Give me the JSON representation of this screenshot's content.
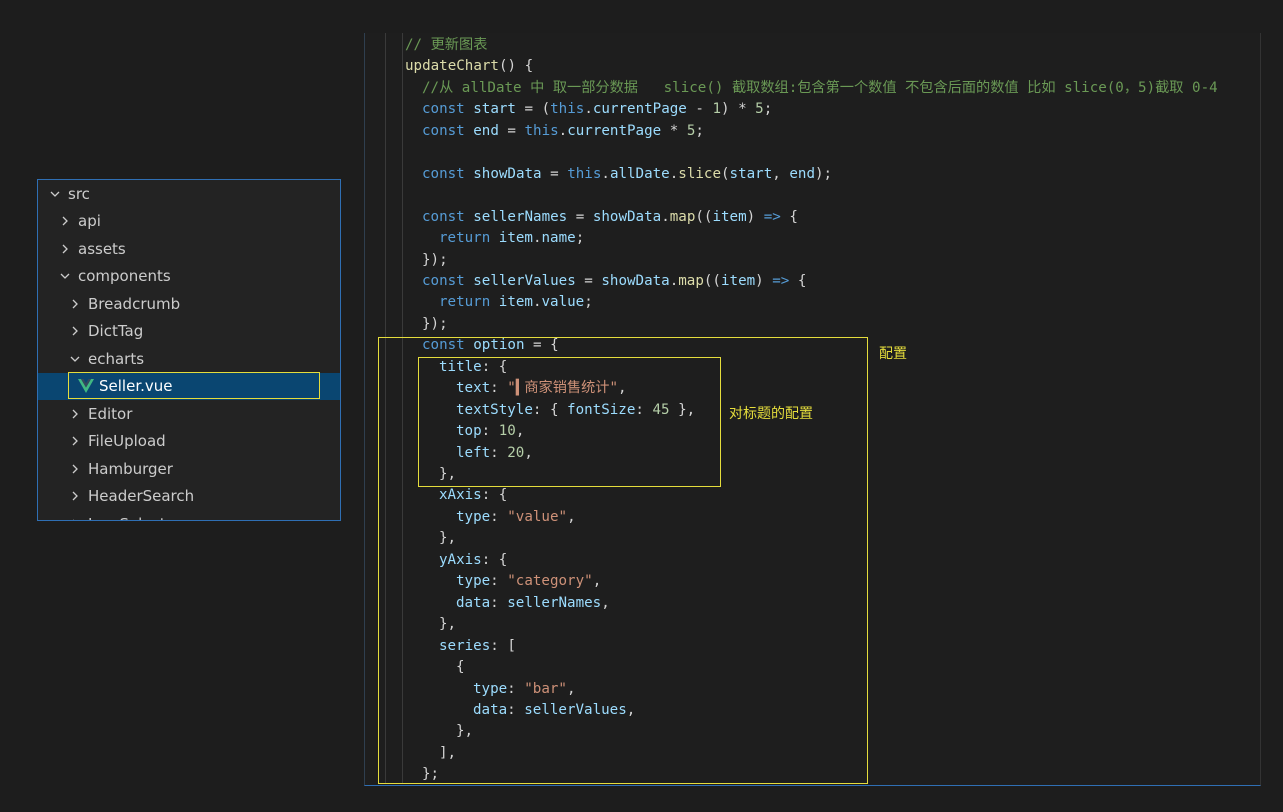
{
  "explorer": {
    "items": [
      {
        "label": "src",
        "state": "open",
        "indent": 0
      },
      {
        "label": "api",
        "state": "closed",
        "indent": 1
      },
      {
        "label": "assets",
        "state": "closed",
        "indent": 1
      },
      {
        "label": "components",
        "state": "open",
        "indent": 1
      },
      {
        "label": "Breadcrumb",
        "state": "closed",
        "indent": 2
      },
      {
        "label": "DictTag",
        "state": "closed",
        "indent": 2
      },
      {
        "label": "echarts",
        "state": "open",
        "indent": 2
      },
      {
        "label": "Seller.vue",
        "state": "file",
        "indent": 3,
        "selected": true
      },
      {
        "label": "Editor",
        "state": "closed",
        "indent": 2
      },
      {
        "label": "FileUpload",
        "state": "closed",
        "indent": 2
      },
      {
        "label": "Hamburger",
        "state": "closed",
        "indent": 2
      },
      {
        "label": "HeaderSearch",
        "state": "closed",
        "indent": 2
      },
      {
        "label": "IconSelect",
        "state": "closed",
        "indent": 2
      }
    ],
    "accent_color": "#2f6fb4",
    "vue_icon_color": "#41b883"
  },
  "code": {
    "lines": [
      {
        "indent": 2,
        "tokens": [
          [
            "cmt",
            "// 更新图表"
          ]
        ]
      },
      {
        "indent": 2,
        "tokens": [
          [
            "fn",
            "updateChart"
          ],
          [
            "txt",
            "() {"
          ]
        ]
      },
      {
        "indent": 3,
        "tokens": [
          [
            "cmt",
            "//从 allDate 中 取一部分数据   slice() 截取数组:包含第一个数值 不包含后面的数值 比如 slice(0，5)截取 0-4"
          ]
        ]
      },
      {
        "indent": 3,
        "tokens": [
          [
            "kw",
            "const "
          ],
          [
            "var",
            "start"
          ],
          [
            "txt",
            " = ("
          ],
          [
            "kw",
            "this"
          ],
          [
            "txt",
            "."
          ],
          [
            "var",
            "currentPage"
          ],
          [
            "txt",
            " - "
          ],
          [
            "num",
            "1"
          ],
          [
            "txt",
            ") * "
          ],
          [
            "num",
            "5"
          ],
          [
            "txt",
            ";"
          ]
        ]
      },
      {
        "indent": 3,
        "tokens": [
          [
            "kw",
            "const "
          ],
          [
            "var",
            "end"
          ],
          [
            "txt",
            " = "
          ],
          [
            "kw",
            "this"
          ],
          [
            "txt",
            "."
          ],
          [
            "var",
            "currentPage"
          ],
          [
            "txt",
            " * "
          ],
          [
            "num",
            "5"
          ],
          [
            "txt",
            ";"
          ]
        ]
      },
      {
        "indent": 3,
        "tokens": []
      },
      {
        "indent": 3,
        "tokens": [
          [
            "kw",
            "const "
          ],
          [
            "var",
            "showData"
          ],
          [
            "txt",
            " = "
          ],
          [
            "kw",
            "this"
          ],
          [
            "txt",
            "."
          ],
          [
            "var",
            "allDate"
          ],
          [
            "txt",
            "."
          ],
          [
            "fn",
            "slice"
          ],
          [
            "txt",
            "("
          ],
          [
            "var",
            "start"
          ],
          [
            "txt",
            ", "
          ],
          [
            "var",
            "end"
          ],
          [
            "txt",
            ");"
          ]
        ]
      },
      {
        "indent": 3,
        "tokens": []
      },
      {
        "indent": 3,
        "tokens": [
          [
            "kw",
            "const "
          ],
          [
            "var",
            "sellerNames"
          ],
          [
            "txt",
            " = "
          ],
          [
            "var",
            "showData"
          ],
          [
            "txt",
            "."
          ],
          [
            "fn",
            "map"
          ],
          [
            "txt",
            "(("
          ],
          [
            "var",
            "item"
          ],
          [
            "txt",
            ") "
          ],
          [
            "kw",
            "=>"
          ],
          [
            "txt",
            " {"
          ]
        ]
      },
      {
        "indent": 4,
        "tokens": [
          [
            "kw",
            "return "
          ],
          [
            "var",
            "item"
          ],
          [
            "txt",
            "."
          ],
          [
            "var",
            "name"
          ],
          [
            "txt",
            ";"
          ]
        ]
      },
      {
        "indent": 3,
        "tokens": [
          [
            "txt",
            "});"
          ]
        ]
      },
      {
        "indent": 3,
        "tokens": [
          [
            "kw",
            "const "
          ],
          [
            "var",
            "sellerValues"
          ],
          [
            "txt",
            " = "
          ],
          [
            "var",
            "showData"
          ],
          [
            "txt",
            "."
          ],
          [
            "fn",
            "map"
          ],
          [
            "txt",
            "(("
          ],
          [
            "var",
            "item"
          ],
          [
            "txt",
            ") "
          ],
          [
            "kw",
            "=>"
          ],
          [
            "txt",
            " {"
          ]
        ]
      },
      {
        "indent": 4,
        "tokens": [
          [
            "kw",
            "return "
          ],
          [
            "var",
            "item"
          ],
          [
            "txt",
            "."
          ],
          [
            "var",
            "value"
          ],
          [
            "txt",
            ";"
          ]
        ]
      },
      {
        "indent": 3,
        "tokens": [
          [
            "txt",
            "});"
          ]
        ]
      },
      {
        "indent": 3,
        "tokens": [
          [
            "kw",
            "const "
          ],
          [
            "var",
            "option"
          ],
          [
            "txt",
            " = {"
          ]
        ]
      },
      {
        "indent": 4,
        "tokens": [
          [
            "var",
            "title"
          ],
          [
            "txt",
            ": {"
          ]
        ]
      },
      {
        "indent": 5,
        "tokens": [
          [
            "var",
            "text"
          ],
          [
            "txt",
            ": "
          ],
          [
            "str",
            "\"▍商家销售统计\""
          ],
          [
            "txt",
            ","
          ]
        ]
      },
      {
        "indent": 5,
        "tokens": [
          [
            "var",
            "textStyle"
          ],
          [
            "txt",
            ": { "
          ],
          [
            "var",
            "fontSize"
          ],
          [
            "txt",
            ": "
          ],
          [
            "num",
            "45"
          ],
          [
            "txt",
            " },"
          ]
        ]
      },
      {
        "indent": 5,
        "tokens": [
          [
            "var",
            "top"
          ],
          [
            "txt",
            ": "
          ],
          [
            "num",
            "10"
          ],
          [
            "txt",
            ","
          ]
        ]
      },
      {
        "indent": 5,
        "tokens": [
          [
            "var",
            "left"
          ],
          [
            "txt",
            ": "
          ],
          [
            "num",
            "20"
          ],
          [
            "txt",
            ","
          ]
        ]
      },
      {
        "indent": 4,
        "tokens": [
          [
            "txt",
            "},"
          ]
        ]
      },
      {
        "indent": 4,
        "tokens": [
          [
            "var",
            "xAxis"
          ],
          [
            "txt",
            ": {"
          ]
        ]
      },
      {
        "indent": 5,
        "tokens": [
          [
            "var",
            "type"
          ],
          [
            "txt",
            ": "
          ],
          [
            "str",
            "\"value\""
          ],
          [
            "txt",
            ","
          ]
        ]
      },
      {
        "indent": 4,
        "tokens": [
          [
            "txt",
            "},"
          ]
        ]
      },
      {
        "indent": 4,
        "tokens": [
          [
            "var",
            "yAxis"
          ],
          [
            "txt",
            ": {"
          ]
        ]
      },
      {
        "indent": 5,
        "tokens": [
          [
            "var",
            "type"
          ],
          [
            "txt",
            ": "
          ],
          [
            "str",
            "\"category\""
          ],
          [
            "txt",
            ","
          ]
        ]
      },
      {
        "indent": 5,
        "tokens": [
          [
            "var",
            "data"
          ],
          [
            "txt",
            ": "
          ],
          [
            "var",
            "sellerNames"
          ],
          [
            "txt",
            ","
          ]
        ]
      },
      {
        "indent": 4,
        "tokens": [
          [
            "txt",
            "},"
          ]
        ]
      },
      {
        "indent": 4,
        "tokens": [
          [
            "var",
            "series"
          ],
          [
            "txt",
            ": ["
          ]
        ]
      },
      {
        "indent": 5,
        "tokens": [
          [
            "txt",
            "{"
          ]
        ]
      },
      {
        "indent": 6,
        "tokens": [
          [
            "var",
            "type"
          ],
          [
            "txt",
            ": "
          ],
          [
            "str",
            "\"bar\""
          ],
          [
            "txt",
            ","
          ]
        ]
      },
      {
        "indent": 6,
        "tokens": [
          [
            "var",
            "data"
          ],
          [
            "txt",
            ": "
          ],
          [
            "var",
            "sellerValues"
          ],
          [
            "txt",
            ","
          ]
        ]
      },
      {
        "indent": 5,
        "tokens": [
          [
            "txt",
            "},"
          ]
        ]
      },
      {
        "indent": 4,
        "tokens": [
          [
            "txt",
            "],"
          ]
        ]
      },
      {
        "indent": 3,
        "tokens": [
          [
            "txt",
            "};"
          ]
        ]
      }
    ]
  },
  "annotations": {
    "config_label": "配置",
    "title_config_label": "对标题的配置",
    "highlight_color": "#e5dd3c"
  }
}
